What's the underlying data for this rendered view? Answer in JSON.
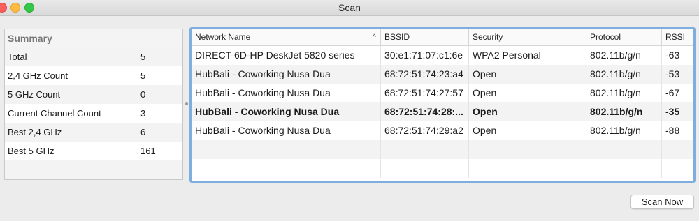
{
  "window": {
    "title": "Scan"
  },
  "summary": {
    "header": "Summary",
    "rows": [
      {
        "label": "Total",
        "value": "5"
      },
      {
        "label": "2,4 GHz Count",
        "value": "5"
      },
      {
        "label": "5 GHz Count",
        "value": "0"
      },
      {
        "label": "Current Channel Count",
        "value": "3"
      },
      {
        "label": "Best 2,4 GHz",
        "value": "6"
      },
      {
        "label": "Best 5 GHz",
        "value": "161"
      }
    ]
  },
  "networks": {
    "columns": [
      "Network Name",
      "BSSID",
      "Security",
      "Protocol",
      "RSSI"
    ],
    "sort_indicator": "^",
    "rows": [
      {
        "name": "DIRECT-6D-HP DeskJet 5820 series",
        "bssid": "30:e1:71:07:c1:6e",
        "security": "WPA2 Personal",
        "protocol": "802.11b/g/n",
        "rssi": "-63",
        "current": false
      },
      {
        "name": "HubBali - Coworking Nusa Dua",
        "bssid": "68:72:51:74:23:a4",
        "security": "Open",
        "protocol": "802.11b/g/n",
        "rssi": "-53",
        "current": false
      },
      {
        "name": "HubBali - Coworking Nusa Dua",
        "bssid": "68:72:51:74:27:57",
        "security": "Open",
        "protocol": "802.11b/g/n",
        "rssi": "-67",
        "current": false
      },
      {
        "name": "HubBali - Coworking Nusa Dua",
        "bssid": "68:72:51:74:28:...",
        "security": "Open",
        "protocol": "802.11b/g/n",
        "rssi": "-35",
        "current": true
      },
      {
        "name": "HubBali - Coworking Nusa Dua",
        "bssid": "68:72:51:74:29:a2",
        "security": "Open",
        "protocol": "802.11b/g/n",
        "rssi": "-88",
        "current": false
      }
    ]
  },
  "actions": {
    "scan_now": "Scan Now"
  },
  "colors": {
    "selection_border": "#7eaee0",
    "close": "#fc605c",
    "minimize": "#fdbc40",
    "maximize": "#34c84a"
  }
}
